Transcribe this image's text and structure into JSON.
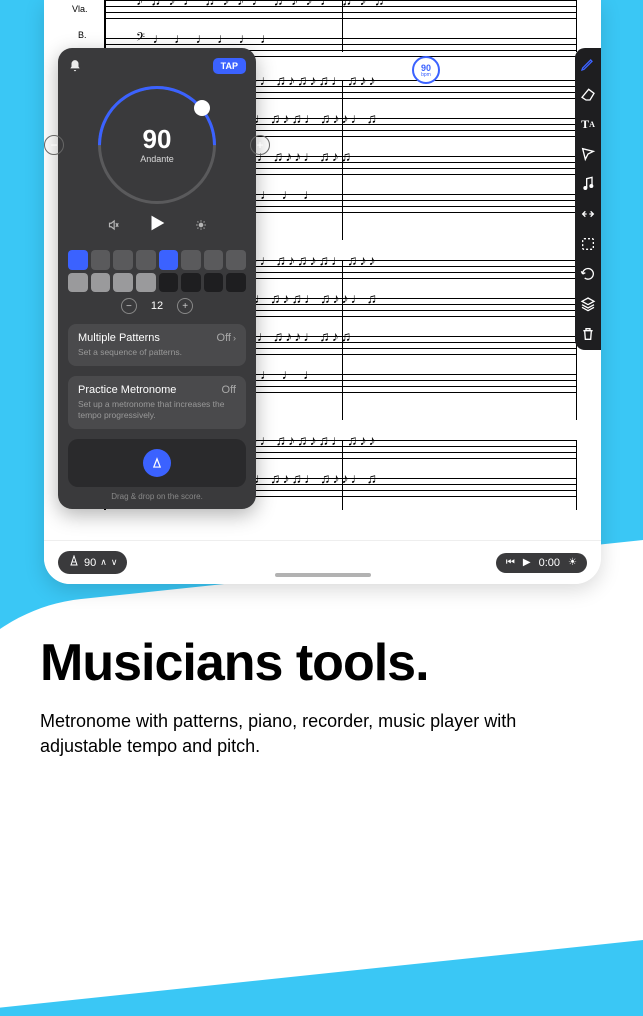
{
  "score": {
    "instruments": [
      "Vla.",
      "B."
    ],
    "tempo_marker": {
      "bpm": "90",
      "sublabel": "bpm"
    }
  },
  "metronome": {
    "tap_label": "TAP",
    "bpm": "90",
    "tempo_name": "Andante",
    "pattern_count": "12",
    "options": {
      "multi_patterns": {
        "title": "Multiple Patterns",
        "value": "Off",
        "desc": "Set a sequence of patterns."
      },
      "practice": {
        "title": "Practice Metronome",
        "value": "Off",
        "desc": "Set up a metronome that increases the tempo progressively."
      }
    },
    "drop_hint": "Drag & drop on the score."
  },
  "bottom_bar": {
    "tempo": "90",
    "time": "0:00"
  },
  "marketing": {
    "headline": "Musicians tools.",
    "body": "Metronome with patterns, piano, recorder, music player with adjustable tempo and pitch."
  }
}
